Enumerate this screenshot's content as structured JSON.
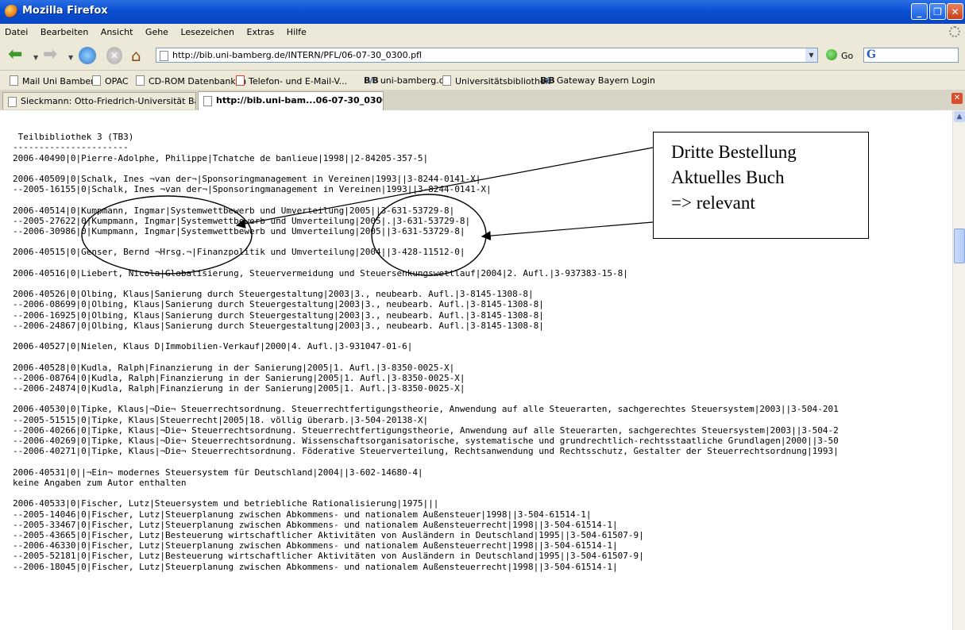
{
  "window": {
    "title": "Mozilla Firefox"
  },
  "menu": [
    "Datei",
    "Bearbeiten",
    "Ansicht",
    "Gehe",
    "Lesezeichen",
    "Extras",
    "Hilfe"
  ],
  "nav": {
    "url": "http://bib.uni-bamberg.de/INTERN/PFL/06-07-30_0300.pfl",
    "go_label": "Go",
    "search_logo": "G"
  },
  "bookmarks": [
    "Mail Uni Bamberg",
    "OPAC",
    "CD-ROM Datenbanken",
    "Telefon- und E-Mail-V...",
    "uni-bamberg.de",
    "Universitätsbibliothek",
    "Gateway Bayern Login"
  ],
  "tabs": [
    {
      "label": "Sieckmann: Otto-Friedrich-Universität Bamb..."
    },
    {
      "label": "http://bib.uni-bam...06-07-30_0300.pfl"
    }
  ],
  "annotation": {
    "line1": "Dritte Bestellung",
    "line2": "Aktuelles Buch",
    "line3": "=> relevant"
  },
  "lines": [
    "",
    " Teilbibliothek 3 (TB3)",
    "----------------------",
    "2006-40490|0|Pierre-Adolphe, Philippe|Tchatche de banlieue|1998||2-84205-357-5|",
    "",
    "2006-40509|0|Schalk, Ines ¬van der¬|Sponsoringmanagement in Vereinen|1993||3-8244-0141-X|",
    "--2005-16155|0|Schalk, Ines ¬van der¬|Sponsoringmanagement in Vereinen|1993||3-8244-0141-X|",
    "",
    "2006-40514|0|Kumpmann, Ingmar|Systemwettbewerb und Umverteilung|2005||3-631-53729-8|",
    "--2005-27622|0|Kumpmann, Ingmar|Systemwettbewerb und Umverteilung|2005|.|3-631-53729-8|",
    "--2006-30986|0|Kumpmann, Ingmar|Systemwettbewerb und Umverteilung|2005||3-631-53729-8|",
    "",
    "2006-40515|0|Genser, Bernd ¬Hrsg.¬|Finanzpolitik und Umverteilung|2004||3-428-11512-0|",
    "",
    "2006-40516|0|Liebert, Nicola|Globalisierung, Steuervermeidung und Steuersenkungswettlauf|2004|2. Aufl.|3-937383-15-8|",
    "",
    "2006-40526|0|Olbing, Klaus|Sanierung durch Steuergestaltung|2003|3., neubearb. Aufl.|3-8145-1308-8|",
    "--2006-08699|0|Olbing, Klaus|Sanierung durch Steuergestaltung|2003|3., neubearb. Aufl.|3-8145-1308-8|",
    "--2006-16925|0|Olbing, Klaus|Sanierung durch Steuergestaltung|2003|3., neubearb. Aufl.|3-8145-1308-8|",
    "--2006-24867|0|Olbing, Klaus|Sanierung durch Steuergestaltung|2003|3., neubearb. Aufl.|3-8145-1308-8|",
    "",
    "2006-40527|0|Nielen, Klaus D|Immobilien-Verkauf|2000|4. Aufl.|3-931047-01-6|",
    "",
    "2006-40528|0|Kudla, Ralph|Finanzierung in der Sanierung|2005|1. Aufl.|3-8350-0025-X|",
    "--2006-08764|0|Kudla, Ralph|Finanzierung in der Sanierung|2005|1. Aufl.|3-8350-0025-X|",
    "--2006-24874|0|Kudla, Ralph|Finanzierung in der Sanierung|2005|1. Aufl.|3-8350-0025-X|",
    "",
    "2006-40530|0|Tipke, Klaus|¬Die¬ Steuerrechtsordnung. Steuerrechtfertigungstheorie, Anwendung auf alle Steuerarten, sachgerechtes Steuersystem|2003||3-504-201",
    "--2005-51515|0|Tipke, Klaus|Steuerrecht|2005|18. völlig überarb.|3-504-20138-X|",
    "--2006-40266|0|Tipke, Klaus|¬Die¬ Steuerrechtsordnung. Steuerrechtfertigungstheorie, Anwendung auf alle Steuerarten, sachgerechtes Steuersystem|2003||3-504-2",
    "--2006-40269|0|Tipke, Klaus|¬Die¬ Steuerrechtsordnung. Wissenschaftsorganisatorische, systematische und grundrechtlich-rechtsstaatliche Grundlagen|2000||3-50",
    "--2006-40271|0|Tipke, Klaus|¬Die¬ Steuerrechtsordnung. Föderative Steuerverteilung, Rechtsanwendung und Rechtsschutz, Gestalter der Steuerrechtsordnung|1993|",
    "",
    "2006-40531|0||¬Ein¬ modernes Steuersystem für Deutschland|2004||3-602-14680-4|",
    "keine Angaben zum Autor enthalten",
    "",
    "2006-40533|0|Fischer, Lutz|Steuersystem und betriebliche Rationalisierung|1975|||",
    "--2005-14046|0|Fischer, Lutz|Steuerplanung zwischen Abkommens- und nationalem Außensteuer|1998||3-504-61514-1|",
    "--2005-33467|0|Fischer, Lutz|Steuerplanung zwischen Abkommens- und nationalem Außensteuerrecht|1998||3-504-61514-1|",
    "--2005-43665|0|Fischer, Lutz|Besteuerung wirtschaftlicher Aktivitäten von Ausländern in Deutschland|1995||3-504-61507-9|",
    "--2006-46330|0|Fischer, Lutz|Steuerplanung zwischen Abkommens- und nationalem Außensteuerrecht|1998||3-504-61514-1|",
    "--2005-52181|0|Fischer, Lutz|Besteuerung wirtschaftlicher Aktivitäten von Ausländern in Deutschland|1995||3-504-61507-9|",
    "--2006-18045|0|Fischer, Lutz|Steuerplanung zwischen Abkommens- und nationalem Außensteuerrecht|1998||3-504-61514-1|"
  ]
}
